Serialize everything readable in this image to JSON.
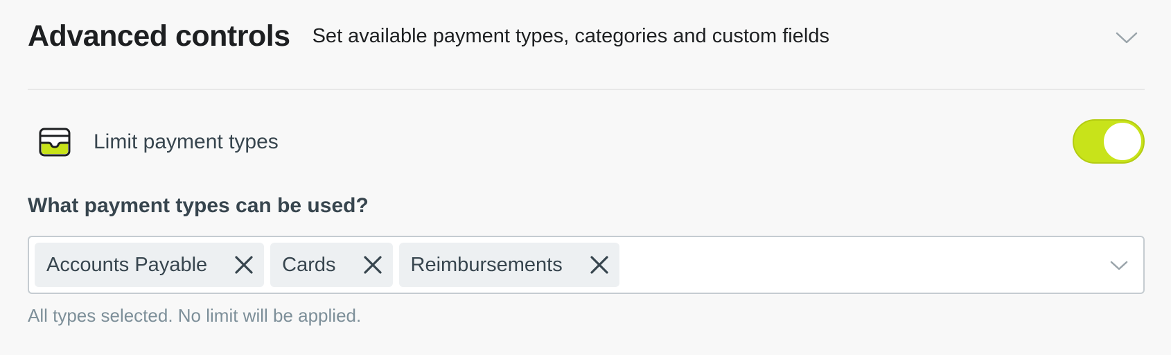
{
  "header": {
    "title": "Advanced controls",
    "subtitle": "Set available payment types, categories and custom fields",
    "chevron_icon": "chevron-down-icon"
  },
  "limit_payment_types": {
    "icon": "card-icon",
    "label": "Limit payment types",
    "toggle_on": true,
    "toggle_color": "#c8e31a"
  },
  "payment_types": {
    "question": "What payment types can be used?",
    "selected": [
      {
        "label": "Accounts Payable",
        "remove_icon": "close-icon"
      },
      {
        "label": "Cards",
        "remove_icon": "close-icon"
      },
      {
        "label": "Reimbursements",
        "remove_icon": "close-icon"
      }
    ],
    "dropdown_icon": "chevron-down-icon",
    "helper_text": "All types selected. No limit will be applied."
  }
}
